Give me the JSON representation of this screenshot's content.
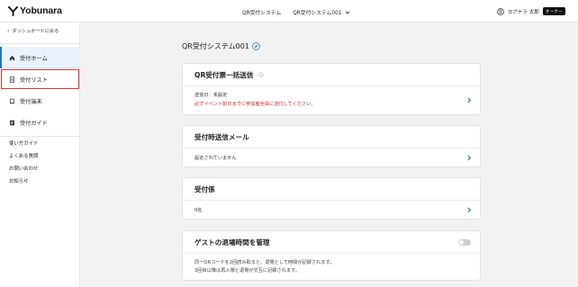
{
  "brand": {
    "name": "Yobunara"
  },
  "header": {
    "crumb_system": "QR受付システム",
    "crumb_instance": "QR受付システム001",
    "user_name": "ヨブナラ 太郎",
    "owner_badge": "オーナー"
  },
  "sidebar": {
    "back": "ダッシュボードに戻る",
    "nav": [
      {
        "label": "受付ホーム",
        "icon": "home-icon"
      },
      {
        "label": "受付リスト",
        "icon": "document-icon"
      },
      {
        "label": "受付端末",
        "icon": "tablet-icon"
      },
      {
        "label": "受付ガイド",
        "icon": "guide-icon"
      }
    ],
    "help_links": [
      "使い方ガイド",
      "よくある質問",
      "お問い合わせ",
      "お知らせ"
    ]
  },
  "main": {
    "title": "QR受付システム001",
    "cards": {
      "bulk_send": {
        "title": "QR受付票一括送信",
        "send_date": "送信日：未設定",
        "warning": "必ずイベント前日までに参加者全員に送付してください。"
      },
      "reception_mail": {
        "title": "受付時送信メール",
        "status": "設定されていません"
      },
      "staff": {
        "title": "受付係",
        "count": "0名"
      },
      "exit_time": {
        "title": "ゲストの退場時間を管理",
        "note1": "同一QRコードを2回読み取ると、退場として時間が記録されます。",
        "note2": "3回目以降は再入場と退場が交互に記録されます。",
        "toggle_on": false
      }
    }
  },
  "colors": {
    "accent": "#1b75d0",
    "warning": "#e02020",
    "highlight": "#d9383a"
  }
}
